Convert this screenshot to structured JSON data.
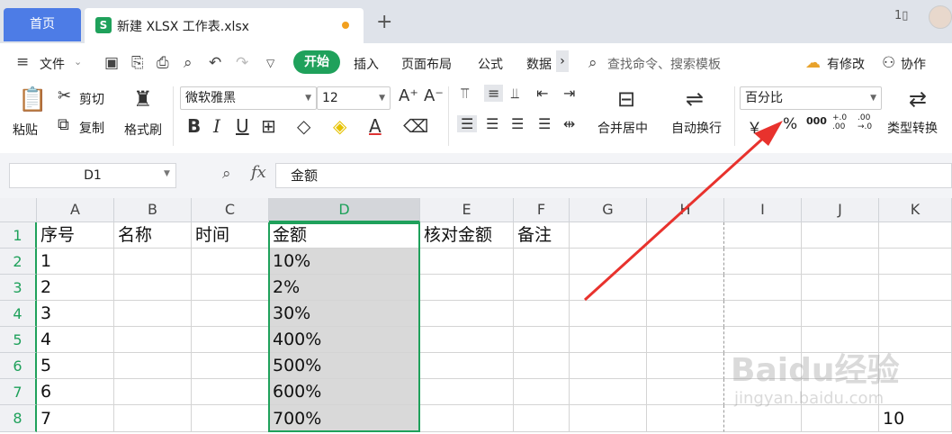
{
  "tabs": {
    "home_label": "首页",
    "file_icon": "S",
    "file_label": "新建 XLSX 工作表.xlsx",
    "new_tab_label": "+"
  },
  "menu": {
    "file_label": "文件",
    "start_label": "开始",
    "items": [
      "插入",
      "页面布局",
      "公式",
      "数据"
    ],
    "more_label": "›",
    "search_label": "查找命令、搜索模板",
    "update_label": "有修改",
    "collab_label": "协作"
  },
  "ribbon": {
    "paste_label": "粘贴",
    "cut_label": "剪切",
    "copy_label": "复制",
    "format_painter_label": "格式刷",
    "font_name": "微软雅黑",
    "font_size": "12",
    "merge_label": "合并居中",
    "wrap_label": "自动换行",
    "number_format": "百分比",
    "currency_label": "￥",
    "percent_label": "%",
    "thousands_label": "000",
    "inc_decimal_label": "+.0 .00",
    "dec_decimal_label": ".00 →.0",
    "convert_label": "类型转换"
  },
  "formula_bar": {
    "name_box": "D1",
    "fx_label": "fx",
    "content": "金额"
  },
  "grid": {
    "columns": [
      "A",
      "B",
      "C",
      "D",
      "E",
      "F",
      "G",
      "H",
      "I",
      "J",
      "K"
    ],
    "rows": [
      "1",
      "2",
      "3",
      "4",
      "5",
      "6",
      "7",
      "8"
    ],
    "row1": [
      "序号",
      "名称",
      "时间",
      "金额",
      "核对金额",
      "备注"
    ],
    "col_a": [
      "1",
      "2",
      "3",
      "4",
      "5",
      "6",
      "7"
    ],
    "col_d": [
      "10%",
      "2%",
      "30%",
      "400%",
      "500%",
      "600%",
      "700%"
    ],
    "k8": "10"
  },
  "watermark": {
    "brand": "Baidu经验",
    "url": "jingyan.baidu.com"
  },
  "colors": {
    "accent": "#1fa15b",
    "home_tab": "#4d7ce6",
    "arrow": "#e8322d"
  }
}
